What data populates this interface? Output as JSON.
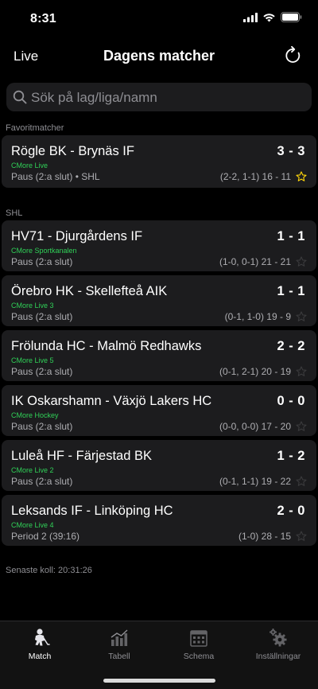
{
  "status_bar": {
    "time": "8:31"
  },
  "nav": {
    "left_label": "Live",
    "title": "Dagens matcher"
  },
  "search": {
    "placeholder": "Sök på lag/liga/namn"
  },
  "sections": {
    "favorites_header": "Favoritmatcher",
    "shl_header": "SHL"
  },
  "favorite_matches": [
    {
      "teams": "Rögle BK - Brynäs IF",
      "score": "3 - 3",
      "channel": "CMore Live",
      "status": "Paus (2:a slut)  •  SHL",
      "period_scores": "(2-2, 1-1) 16 - 11",
      "favorited": true
    }
  ],
  "shl_matches": [
    {
      "teams": "HV71 - Djurgårdens IF",
      "score": "1 - 1",
      "channel": "CMore Sportkanalen",
      "status": "Paus (2:a slut)",
      "period_scores": "(1-0, 0-1) 21 - 21",
      "favorited": false
    },
    {
      "teams": "Örebro HK - Skellefteå AIK",
      "score": "1 - 1",
      "channel": "CMore Live 3",
      "status": "Paus (2:a slut)",
      "period_scores": "(0-1, 1-0) 19 - 9",
      "favorited": false
    },
    {
      "teams": "Frölunda HC - Malmö Redhawks",
      "score": "2 - 2",
      "channel": "CMore Live 5",
      "status": "Paus (2:a slut)",
      "period_scores": "(0-1, 2-1) 20 - 19",
      "favorited": false
    },
    {
      "teams": "IK Oskarshamn - Växjö Lakers HC",
      "score": "0 - 0",
      "channel": "CMore Hockey",
      "status": "Paus (2:a slut)",
      "period_scores": "(0-0, 0-0) 17 - 20",
      "favorited": false
    },
    {
      "teams": "Luleå HF - Färjestad BK",
      "score": "1 - 2",
      "channel": "CMore Live 2",
      "status": "Paus (2:a slut)",
      "period_scores": "(0-1, 1-1) 19 - 22",
      "favorited": false
    },
    {
      "teams": "Leksands IF - Linköping HC",
      "score": "2 - 0",
      "channel": "CMore Live 4",
      "status": "Period 2 (39:16)",
      "period_scores": "(1-0) 28 - 15",
      "favorited": false
    }
  ],
  "last_check": "Senaste koll: 20:31:26",
  "tabs": [
    {
      "label": "Match",
      "icon": "hockey-player-icon",
      "active": true
    },
    {
      "label": "Tabell",
      "icon": "bar-chart-icon",
      "active": false
    },
    {
      "label": "Schema",
      "icon": "calendar-icon",
      "active": false
    },
    {
      "label": "Inställningar",
      "icon": "gears-icon",
      "active": false
    }
  ],
  "colors": {
    "background": "#000000",
    "card": "#1c1c1e",
    "channel": "#30d158",
    "favorite_star": "#ffd60a",
    "muted": "#8e8e93"
  }
}
